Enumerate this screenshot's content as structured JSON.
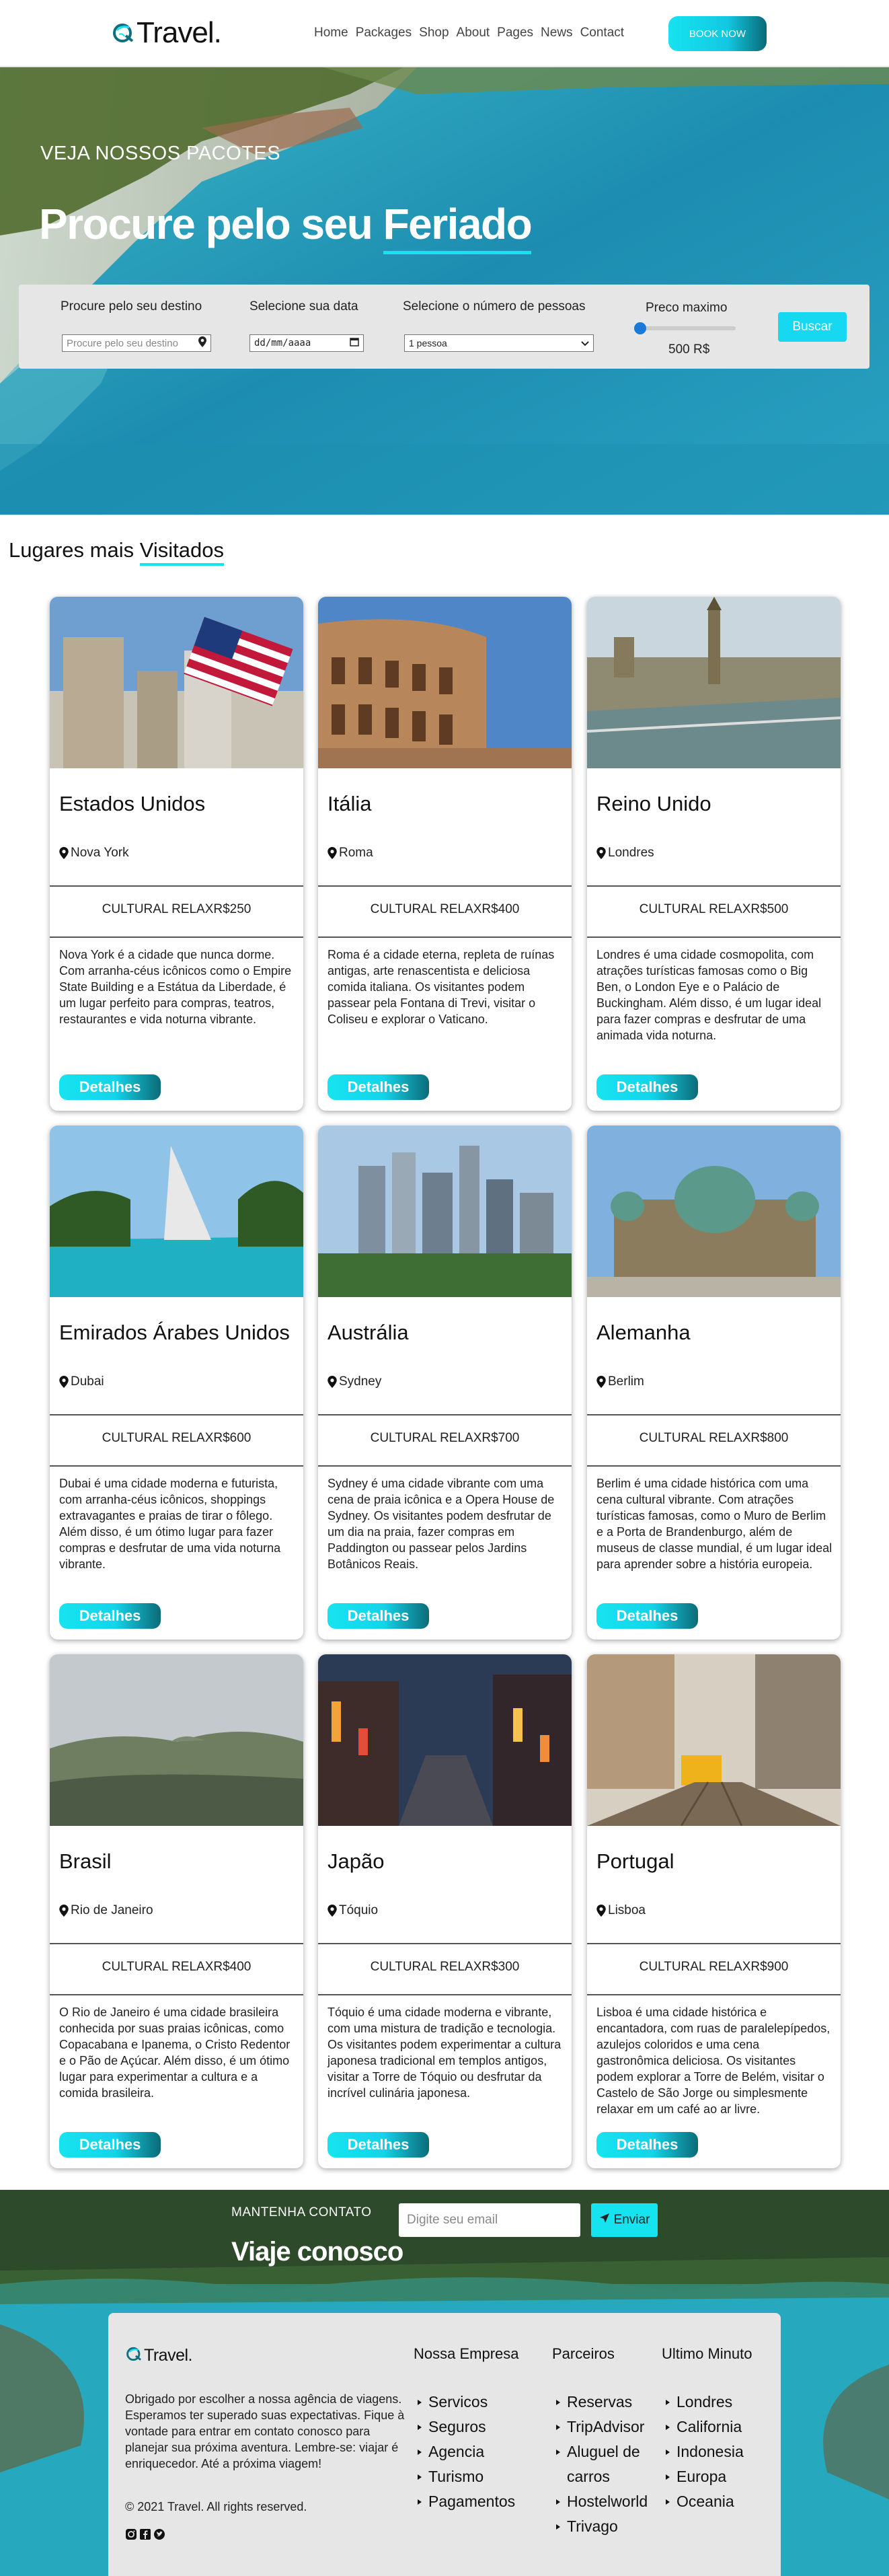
{
  "brand": {
    "name": "Travel.",
    "accent": "#16e3f0"
  },
  "nav": {
    "items": [
      "Home",
      "Packages",
      "Shop",
      "About",
      "Pages",
      "News",
      "Contact"
    ],
    "cta": "BOOK NOW"
  },
  "hero": {
    "subtitle": "VEJA NOSSOS PACOTES",
    "title_prefix": "Procure pelo seu ",
    "title_highlight": "Feriado"
  },
  "search": {
    "destination_label": "Procure pelo seu destino",
    "destination_placeholder": "Procure pelo seu destino",
    "date_label": "Selecione sua data",
    "date_placeholder": "dd/mm/aaaa",
    "people_label": "Selecione o número de pessoas",
    "people_value": "1 pessoa",
    "price_label": "Preco maximo",
    "price_value": "500 R$",
    "price_slider_fraction": 0.0,
    "submit": "Buscar"
  },
  "section": {
    "title_prefix": "Lugares mais ",
    "title_highlight": "Visitados"
  },
  "cards": [
    {
      "country": "Estados Unidos",
      "city": "Nova York",
      "tags": "CULTURAL RELAXR$250",
      "desc": "Nova York é a cidade que nunca dorme. Com arranha-céus icônicos como o Empire State Building e a Estátua da Liberdade, é um lugar perfeito para compras, teatros, restaurantes e vida noturna vibrante.",
      "button": "Detalhes"
    },
    {
      "country": "Itália",
      "city": "Roma",
      "tags": "CULTURAL RELAXR$400",
      "desc": "Roma é a cidade eterna, repleta de ruínas antigas, arte renascentista e deliciosa comida italiana. Os visitantes podem passear pela Fontana di Trevi, visitar o Coliseu e explorar o Vaticano.",
      "button": "Detalhes"
    },
    {
      "country": "Reino Unido",
      "city": "Londres",
      "tags": "CULTURAL RELAXR$500",
      "desc": "Londres é uma cidade cosmopolita, com atrações turísticas famosas como o Big Ben, o London Eye e o Palácio de Buckingham. Além disso, é um lugar ideal para fazer compras e desfrutar de uma animada vida noturna.",
      "button": "Detalhes"
    },
    {
      "country": "Emirados Árabes Unidos",
      "city": "Dubai",
      "tags": "CULTURAL RELAXR$600",
      "desc": "Dubai é uma cidade moderna e futurista, com arranha-céus icônicos, shoppings extravagantes e praias de tirar o fôlego. Além disso, é um ótimo lugar para fazer compras e desfrutar de uma vida noturna vibrante.",
      "button": "Detalhes"
    },
    {
      "country": "Austrália",
      "city": "Sydney",
      "tags": "CULTURAL RELAXR$700",
      "desc": "Sydney é uma cidade vibrante com uma cena de praia icônica e a Opera House de Sydney. Os visitantes podem desfrutar de um dia na praia, fazer compras em Paddington ou passear pelos Jardins Botânicos Reais.",
      "button": "Detalhes"
    },
    {
      "country": "Alemanha",
      "city": "Berlim",
      "tags": "CULTURAL RELAXR$800",
      "desc": "Berlim é uma cidade histórica com uma cena cultural vibrante. Com atrações turísticas famosas, como o Muro de Berlim e a Porta de Brandenburgo, além de museus de classe mundial, é um lugar ideal para aprender sobre a história europeia.",
      "button": "Detalhes"
    },
    {
      "country": "Brasil",
      "city": "Rio de Janeiro",
      "tags": "CULTURAL RELAXR$400",
      "desc": "O Rio de Janeiro é uma cidade brasileira conhecida por suas praias icônicas, como Copacabana e Ipanema, o Cristo Redentor e o Pão de Açúcar. Além disso, é um ótimo lugar para experimentar a cultura e a comida brasileira.",
      "button": "Detalhes"
    },
    {
      "country": "Japão",
      "city": "Tóquio",
      "tags": "CULTURAL RELAXR$300",
      "desc": "Tóquio é uma cidade moderna e vibrante, com uma mistura de tradição e tecnologia. Os visitantes podem experimentar a cultura japonesa tradicional em templos antigos, visitar a Torre de Tóquio ou desfrutar da incrível culinária japonesa.",
      "button": "Detalhes"
    },
    {
      "country": "Portugal",
      "city": "Lisboa",
      "tags": "CULTURAL RELAXR$900",
      "desc": "Lisboa é uma cidade histórica e encantadora, com ruas de paralelepípedos, azulejos coloridos e uma cena gastronômica deliciosa. Os visitantes podem explorar a Torre de Belém, visitar o Castelo de São Jorge ou simplesmente relaxar em um café ao ar livre.",
      "button": "Detalhes"
    }
  ],
  "footer": {
    "newsletter_label": "MANTENHA CONTATO",
    "newsletter_title": "Viaje conosco",
    "email_placeholder": "Digite seu email",
    "send": "Enviar",
    "about": "Obrigado por escolher a nossa agência de viagens. Esperamos ter superado suas expectativas. Fique à vontade para entrar em contato conosco para planejar sua próxima aventura. Lembre-se: viajar é enriquecedor. Até a próxima viagem!",
    "copyright": "© 2021 Travel. All rights reserved.",
    "columns": [
      {
        "title": "Nossa Empresa",
        "items": [
          "Servicos",
          "Seguros",
          "Agencia",
          "Turismo",
          "Pagamentos"
        ]
      },
      {
        "title": "Parceiros",
        "items": [
          "Reservas",
          "TripAdvisor",
          "Aluguel de carros",
          "Hostelworld",
          "Trivago"
        ]
      },
      {
        "title": "Ultimo Minuto",
        "items": [
          "Londres",
          "California",
          "Indonesia",
          "Europa",
          "Oceania"
        ]
      }
    ]
  }
}
